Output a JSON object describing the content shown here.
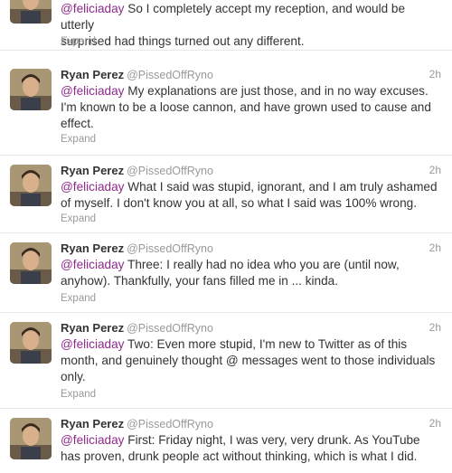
{
  "tweets": [
    {
      "mention": "@feliciaday",
      "text": " So I completely accept my reception, and would be utterly\nsurprised had things turned out any different.",
      "expand": "Expand"
    },
    {
      "fullname": "Ryan Perez",
      "username": "@PissedOffRyno",
      "time": "2h",
      "mention": "@feliciaday",
      "text": " My explanations are just those, and in no way excuses.\nI'm known to be a loose cannon, and have grown used to cause and\neffect.",
      "expand": "Expand"
    },
    {
      "fullname": "Ryan Perez",
      "username": "@PissedOffRyno",
      "time": "2h",
      "mention": "@feliciaday",
      "text": " What I said was stupid, ignorant, and I am truly ashamed\nof myself. I don't know you at all, so what I said was 100% wrong.",
      "expand": "Expand"
    },
    {
      "fullname": "Ryan Perez",
      "username": "@PissedOffRyno",
      "time": "2h",
      "mention": "@feliciaday",
      "text": " Three: I really had no idea who you are (until now,\nanyhow). Thankfully, your fans filled me in ... kinda.",
      "expand": "Expand"
    },
    {
      "fullname": "Ryan Perez",
      "username": "@PissedOffRyno",
      "time": "2h",
      "mention": "@feliciaday",
      "text": " Two: Even more stupid, I'm new to Twitter as of this\nmonth, and genuinely thought @ messages went to those individuals\nonly.",
      "expand": "Expand"
    },
    {
      "fullname": "Ryan Perez",
      "username": "@PissedOffRyno",
      "time": "2h",
      "mention": "@feliciaday",
      "text": " First: Friday night, I was very, very drunk. As YouTube\nhas proven, drunk people act without thinking, which is what I did."
    }
  ]
}
